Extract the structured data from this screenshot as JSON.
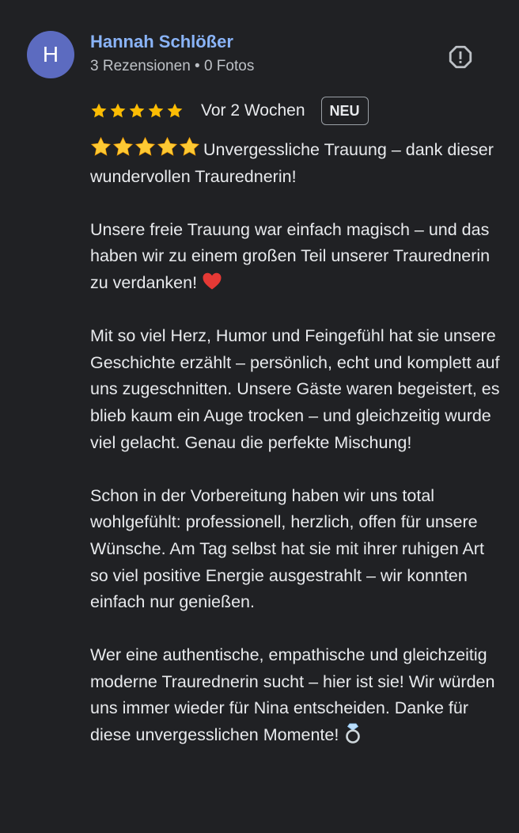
{
  "author": {
    "avatar_initial": "H",
    "name": "Hannah Schlößer",
    "meta": "3 Rezensionen • 0 Fotos"
  },
  "rating": {
    "stars": 5,
    "date": "Vor 2 Wochen",
    "badge": "NEU"
  },
  "icons": {
    "star_color": "#fbbc04",
    "report": "report-icon",
    "heart": "red-heart-emoji",
    "ring": "ring-emoji"
  },
  "review": {
    "paragraphs": [
      {
        "prefix_emoji": "★★★★★",
        "text": "Unvergessliche Trauung – dank dieser wundervollen Traurednerin!"
      },
      {
        "text": "Unsere freie Trauung war einfach magisch – und das haben wir zu einem großen Teil unserer Traurednerin zu verdanken!",
        "suffix_emoji": "❤️"
      },
      {
        "text": "Mit so viel Herz, Humor und Feingefühl hat sie unsere Geschichte erzählt – persönlich, echt und komplett auf uns zugeschnitten. Unsere Gäste waren begeistert, es blieb kaum ein Auge trocken – und gleichzeitig wurde viel gelacht. Genau die perfekte Mischung!"
      },
      {
        "text": "Schon in der Vorbereitung haben wir uns total wohlgefühlt: professionell, herzlich, offen für unsere Wünsche. Am Tag selbst hat sie mit ihrer ruhigen Art so viel positive Energie ausgestrahlt – wir konnten einfach nur genießen."
      },
      {
        "text": "Wer eine authentische, empathische und gleichzeitig moderne Traurednerin sucht – hier ist sie! Wir würden uns immer wieder für Nina entscheiden. Danke für diese unvergesslichen Momente!",
        "suffix_emoji": "💍"
      }
    ]
  }
}
